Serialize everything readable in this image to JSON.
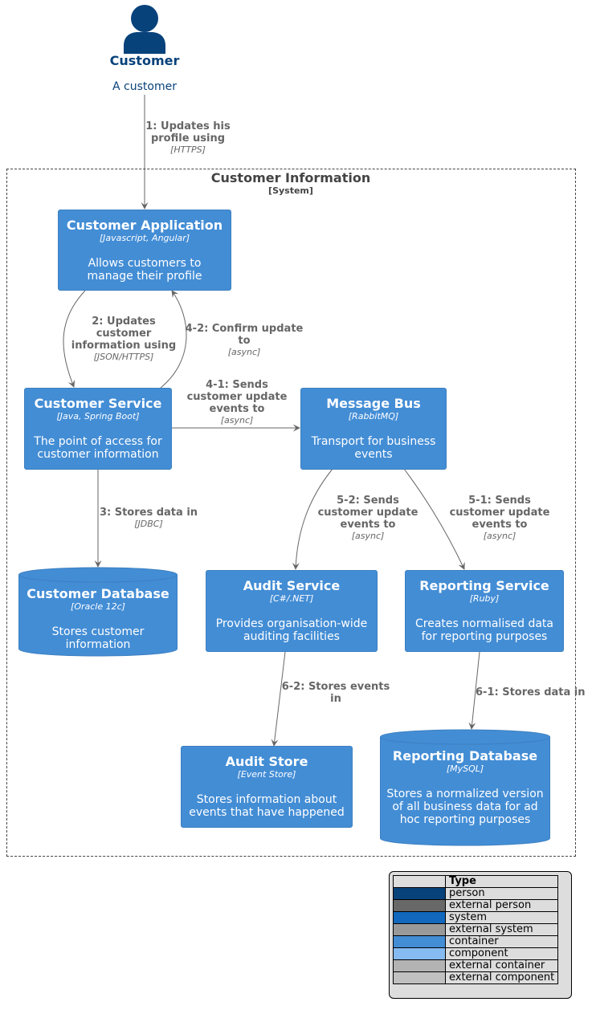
{
  "person": {
    "name": "Customer",
    "description": "A customer",
    "icon": "person-icon",
    "color": "#08427b"
  },
  "boundary": {
    "title": "Customer Information",
    "type": "[System]"
  },
  "containers": {
    "customer_application": {
      "name": "Customer Application",
      "tech": "[Javascript, Angular]",
      "desc": "Allows customers to manage their profile"
    },
    "customer_service": {
      "name": "Customer Service",
      "tech": "[Java, Spring Boot]",
      "desc": "The point of access for customer information"
    },
    "message_bus": {
      "name": "Message Bus",
      "tech": "[RabbitMQ]",
      "desc": "Transport for business events"
    },
    "customer_database": {
      "name": "Customer Database",
      "tech": "[Oracle 12c]",
      "desc": "Stores customer information"
    },
    "audit_service": {
      "name": "Audit Service",
      "tech": "[C#/.NET]",
      "desc": "Provides organisation-wide auditing facilities"
    },
    "reporting_service": {
      "name": "Reporting Service",
      "tech": "[Ruby]",
      "desc": "Creates normalised data for reporting purposes"
    },
    "audit_store": {
      "name": "Audit Store",
      "tech": "[Event Store]",
      "desc": "Stores information about events that have happened"
    },
    "reporting_database": {
      "name": "Reporting Database",
      "tech": "[MySQL]",
      "desc": "Stores a normalized version of all business data for ad hoc reporting purposes"
    }
  },
  "relationships": {
    "r1": {
      "label": "1: Updates his profile using",
      "tech": "[HTTPS]"
    },
    "r2": {
      "label": "2: Updates customer information using",
      "tech": "[JSON/HTTPS]"
    },
    "r42": {
      "label": "4-2: Confirm update to",
      "tech": "[async]"
    },
    "r41": {
      "label": "4-1: Sends customer update events to",
      "tech": "[async]"
    },
    "r3": {
      "label": "3: Stores data in",
      "tech": "[JDBC]"
    },
    "r52": {
      "label": "5-2: Sends customer update events to",
      "tech": "[async]"
    },
    "r51": {
      "label": "5-1: Sends customer update events to",
      "tech": "[async]"
    },
    "r62": {
      "label": "6-2: Stores events in",
      "tech": ""
    },
    "r61": {
      "label": "6-1: Stores data in",
      "tech": ""
    }
  },
  "legend": {
    "header": "Type",
    "rows": [
      {
        "label": "person",
        "color": "#08427b"
      },
      {
        "label": "external person",
        "color": "#686868"
      },
      {
        "label": "system",
        "color": "#1168bd"
      },
      {
        "label": "external system",
        "color": "#999999"
      },
      {
        "label": "container",
        "color": "#438dd5"
      },
      {
        "label": "component",
        "color": "#85bbf0"
      },
      {
        "label": "external container",
        "color": "#b3b3b3"
      },
      {
        "label": "external component",
        "color": "#c0c0c0"
      }
    ]
  }
}
